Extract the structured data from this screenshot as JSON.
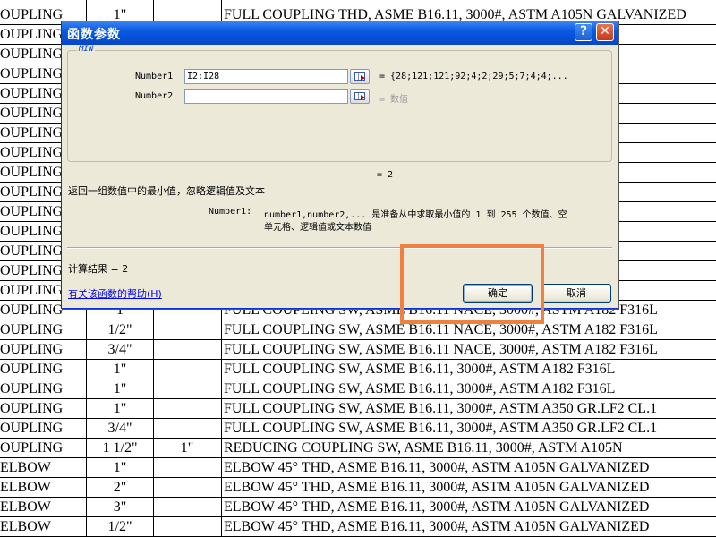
{
  "sheet": {
    "rows": [
      [
        "OUPLING",
        "1\"",
        "",
        "FULL COUPLING THD, ASME B16.11, 3000#, ASTM A105N GALVANIZED"
      ],
      [
        "OUPLING",
        "",
        "",
        "                                               LVANIZED"
      ],
      [
        "OUPLING",
        "",
        "",
        "                                               LVANIZED"
      ],
      [
        "OUPLING",
        "",
        "",
        "                                               LVANIZED"
      ],
      [
        "OUPLING",
        "",
        "",
        "                                               LVANIZED"
      ],
      [
        "OUPLING",
        "",
        "",
        "                                               LVANIZED"
      ],
      [
        "OUPLING",
        "",
        "",
        "                                               LVANIZED"
      ],
      [
        "OUPLING",
        "",
        "",
        "                                               105N"
      ],
      [
        "OUPLING",
        "",
        "",
        "                                               105N"
      ],
      [
        "OUPLING",
        "",
        "",
        "                                               105N"
      ],
      [
        "OUPLING",
        "",
        "",
        "                                               105N"
      ],
      [
        "OUPLING",
        "",
        "",
        ""
      ],
      [
        "OUPLING",
        "",
        "",
        ""
      ],
      [
        "OUPLING",
        "",
        "",
        ""
      ],
      [
        "OUPLING",
        "",
        "",
        ""
      ],
      [
        "OUPLING",
        "1",
        "",
        "FULL COUPLING SW, ASME B16.11 NACE, 3000#, ASTM A182 F316L"
      ],
      [
        "OUPLING",
        "1/2\"",
        "",
        "FULL COUPLING SW, ASME B16.11 NACE, 3000#, ASTM A182 F316L"
      ],
      [
        "OUPLING",
        "3/4\"",
        "",
        "FULL COUPLING SW, ASME B16.11 NACE, 3000#, ASTM A182 F316L"
      ],
      [
        "OUPLING",
        "1\"",
        "",
        "FULL COUPLING SW, ASME B16.11, 3000#, ASTM A182 F316L"
      ],
      [
        "OUPLING",
        "1\"",
        "",
        "FULL COUPLING SW, ASME B16.11, 3000#, ASTM A182 F316L"
      ],
      [
        "OUPLING",
        "1\"",
        "",
        "FULL COUPLING SW, ASME B16.11, 3000#, ASTM A350 GR.LF2 CL.1"
      ],
      [
        "OUPLING",
        "3/4\"",
        "",
        "FULL COUPLING SW, ASME B16.11, 3000#, ASTM A350 GR.LF2 CL.1"
      ],
      [
        "OUPLING",
        "1 1/2\"",
        "1\"",
        "REDUCING COUPLING SW, ASME B16.11, 3000#, ASTM A105N"
      ],
      [
        "ELBOW",
        "1\"",
        "",
        "ELBOW 45° THD, ASME B16.11, 3000#, ASTM A105N GALVANIZED"
      ],
      [
        "ELBOW",
        "2\"",
        "",
        "ELBOW 45° THD, ASME B16.11, 3000#, ASTM A105N GALVANIZED"
      ],
      [
        "ELBOW",
        "3\"",
        "",
        "ELBOW 45° THD, ASME B16.11, 3000#, ASTM A105N GALVANIZED"
      ],
      [
        "ELBOW",
        "1/2\"",
        "",
        "ELBOW 45° THD, ASME B16.11, 3000#, ASTM A105N GALVANIZED"
      ]
    ]
  },
  "dialog": {
    "title": "函数参数",
    "function_name": "MIN",
    "args": [
      {
        "label": "Number1",
        "value": "I2:I28",
        "result": "= {28;121;121;92;4;2;29;5;7;4;4;..."
      },
      {
        "label": "Number2",
        "value": "",
        "result": "= 数值"
      }
    ],
    "formula_result": "= 2",
    "description": "返回一组数值中的最小值，忽略逻辑值及文本",
    "arg_help_label": "Number1:",
    "arg_help_line1": "number1,number2,... 是准备从中求取最小值的 1 到 255 个数值、空",
    "arg_help_line2": "单元格、逻辑值或文本数值",
    "calc_result": "计算结果 = 2",
    "help_link": "有关该函数的帮助(H)",
    "ok_label": "确定",
    "cancel_label": "取消",
    "help_btn": "?",
    "close_btn": "✕"
  },
  "highlight_color": "#f08040"
}
